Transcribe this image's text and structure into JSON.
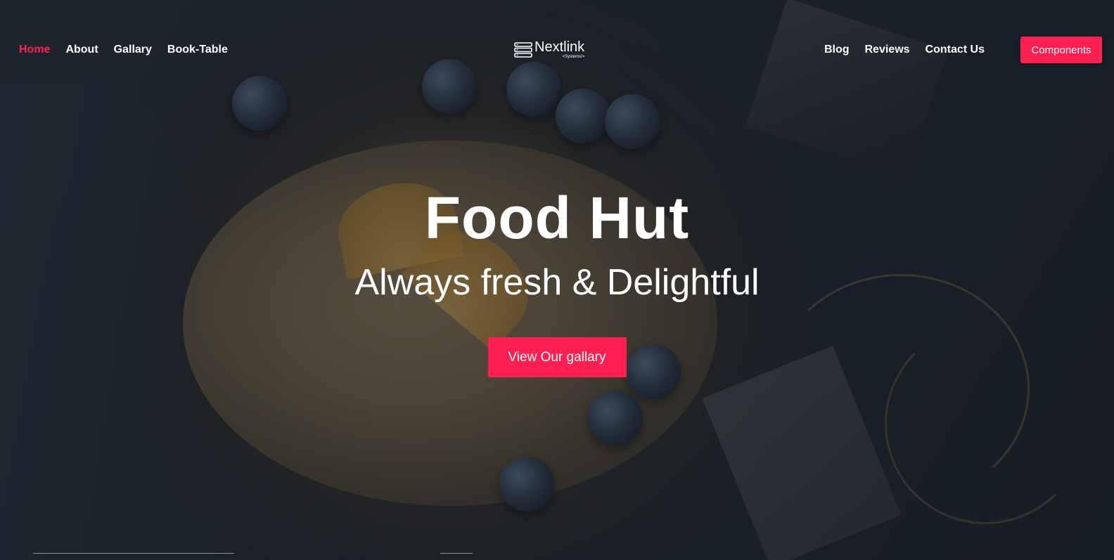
{
  "nav": {
    "left_items": [
      {
        "label": "Home",
        "active": true
      },
      {
        "label": "About",
        "active": false
      },
      {
        "label": "Gallary",
        "active": false
      },
      {
        "label": "Book-Table",
        "active": false
      }
    ],
    "right_items": [
      {
        "label": "Blog"
      },
      {
        "label": "Reviews"
      },
      {
        "label": "Contact Us"
      }
    ],
    "components_label": "Components"
  },
  "brand": {
    "name": "Nextlink",
    "sub": "<Systems/>",
    "icon": "server-stack-icon"
  },
  "hero": {
    "title": "Food Hut",
    "subtitle": "Always fresh & Delightful",
    "cta_label": "View Our gallary"
  },
  "colors": {
    "accent": "#ff1f50",
    "active_link": "#ff2255",
    "text": "#ffffff",
    "background": "#1c212b"
  }
}
